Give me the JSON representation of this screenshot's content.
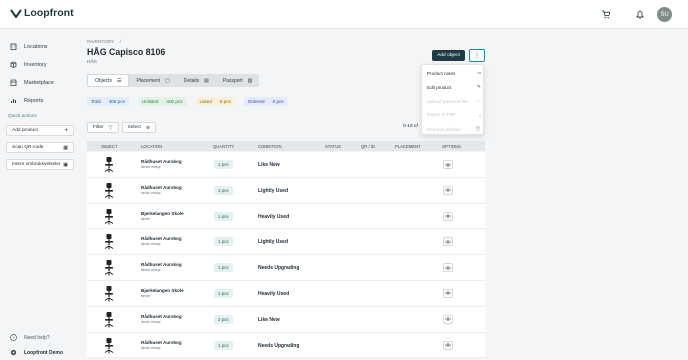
{
  "brand": {
    "name": "Loopfront"
  },
  "user": {
    "initials": "SU"
  },
  "sidebar": {
    "items": [
      {
        "label": "Locations",
        "icon": "building-icon"
      },
      {
        "label": "Inventory",
        "icon": "box-icon"
      },
      {
        "label": "Marketplace",
        "icon": "store-icon"
      },
      {
        "label": "Reports",
        "icon": "chart-icon"
      }
    ],
    "quick_actions_title": "Quick actions",
    "quick_actions": [
      {
        "label": "Add product",
        "icon": "plus-icon"
      },
      {
        "label": "Scan QR-code",
        "icon": "qr-icon"
      },
      {
        "label": "Intern ombruksvelseler",
        "icon": "list-icon"
      }
    ],
    "help": "Need help?",
    "org": "Loopfront Demo"
  },
  "page": {
    "breadcrumb": "INVENTORY",
    "breadcrumb_sep": "/",
    "title": "HÅG Capisco 8106",
    "subtitle": "HÅG",
    "add_object": "Add object",
    "more": "⋮"
  },
  "tabs": [
    {
      "label": "Objects",
      "icon": "☰",
      "active": true
    },
    {
      "label": "Placement",
      "icon": "▢"
    },
    {
      "label": "Details",
      "icon": "▤"
    },
    {
      "label": "Passport",
      "icon": "▥"
    }
  ],
  "stats": [
    {
      "label": "Total",
      "value": "405 pcs",
      "bg": "#e3eef8",
      "fg": "#2a5c8a"
    },
    {
      "label": "Unlisted",
      "value": "400 pcs",
      "bg": "#e2f3e6",
      "fg": "#2a7a3c"
    },
    {
      "label": "Listed",
      "value": "5 pcs",
      "bg": "#fbf0d9",
      "fg": "#8a6510"
    },
    {
      "label": "Ordered",
      "value": "0 pcs",
      "bg": "#e6ecfb",
      "fg": "#2f4fa0"
    }
  ],
  "filters": {
    "filter": "Filter",
    "select": "Select",
    "range": "0-10 of"
  },
  "table": {
    "headers": [
      "OBJECT",
      "LOCATION",
      "QUANTITY",
      "CONDITION",
      "STATUS",
      "QR / ID",
      "PLACEMENT",
      "OPTIONS"
    ],
    "rows": [
      {
        "location": "Rådhuset Aurskog",
        "floor": "første etasje",
        "qty": "1 pcs",
        "condition": "Like New"
      },
      {
        "location": "Rådhuset Aurskog",
        "floor": "første etasje",
        "qty": "1 pcs",
        "condition": "Lightly Used"
      },
      {
        "location": "Bjørkelangen Skole",
        "floor": "første",
        "qty": "1 pcs",
        "condition": "Heavily Used"
      },
      {
        "location": "Rådhuset Aurskog",
        "floor": "første etasje",
        "qty": "1 pcs",
        "condition": "Lightly Used"
      },
      {
        "location": "Rådhuset Aurskog",
        "floor": "første etasje",
        "qty": "1 pcs",
        "condition": "Needs Upgrading"
      },
      {
        "location": "Bjørkelangen Skole",
        "floor": "første",
        "qty": "1 pcs",
        "condition": "Heavily Used"
      },
      {
        "location": "Rådhuset Aurskog",
        "floor": "første etasje",
        "qty": "2 pcs",
        "condition": "Like New"
      },
      {
        "location": "Rådhuset Aurskog",
        "floor": "første etasje",
        "qty": "1 pcs",
        "condition": "Needs Upgrading"
      }
    ]
  },
  "menu": {
    "items": [
      {
        "label": "Product notes",
        "icon": "note-icon",
        "disabled": false
      },
      {
        "label": "Edit product",
        "icon": "pencil-icon",
        "disabled": false
      },
      {
        "label": "Upload passport file",
        "icon": "upload-icon",
        "disabled": true
      },
      {
        "label": "Export to PDF",
        "icon": "download-icon",
        "disabled": true
      },
      {
        "label": "Remove product",
        "icon": "trash-icon",
        "disabled": true
      }
    ]
  }
}
